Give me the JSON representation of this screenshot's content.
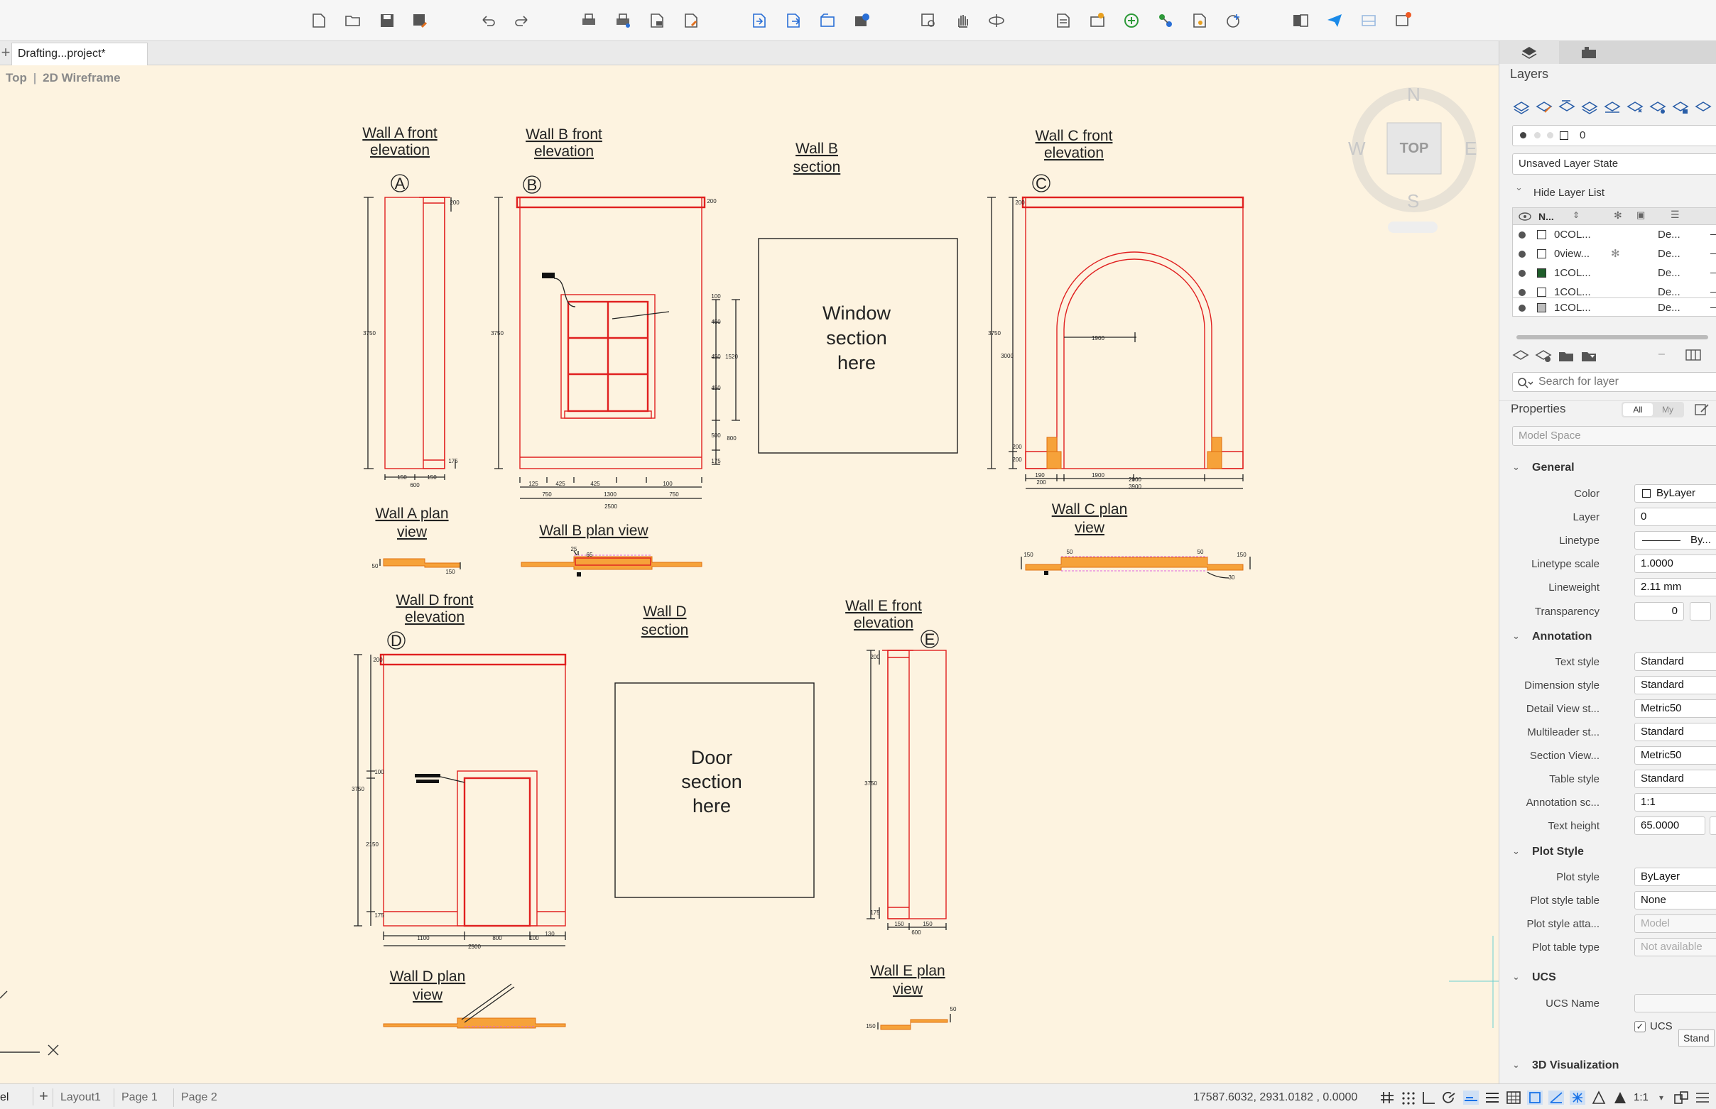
{
  "document": {
    "tab": "Drafting...project*"
  },
  "viewport": {
    "view": "Top",
    "visual_style": "2D Wireframe"
  },
  "navcube": {
    "face": "TOP",
    "north": "N",
    "south": "S",
    "east": "E",
    "west": "W"
  },
  "drawing": {
    "titles": {
      "wall_a_front": [
        "Wall A front",
        "elevation"
      ],
      "wall_b_front": [
        "Wall B front",
        "elevation"
      ],
      "wall_b_section": [
        "Wall B",
        "section"
      ],
      "wall_c_front": [
        "Wall C front",
        "elevation"
      ],
      "wall_a_plan": [
        "Wall A plan",
        "view"
      ],
      "wall_b_plan": "Wall B plan view",
      "wall_c_plan": [
        "Wall C plan",
        "view"
      ],
      "wall_d_front": [
        "Wall D front",
        "elevation"
      ],
      "wall_d_section": [
        "Wall D",
        "section"
      ],
      "wall_e_front": [
        "Wall E front",
        "elevation"
      ],
      "wall_d_plan": [
        "Wall D plan",
        "view"
      ],
      "wall_e_plan": [
        "Wall E plan",
        "view"
      ]
    },
    "boxes": {
      "window_section": [
        "Window",
        "section",
        "here"
      ],
      "door_section": [
        "Door",
        "section",
        "here"
      ]
    },
    "markers": {
      "a": "A",
      "b": "B",
      "c": "C",
      "d": "D",
      "e": "E"
    },
    "dims": {
      "wall_a_height": "3750",
      "wall_a_top": "200",
      "wall_a_base": "175",
      "wall_a_w1": "150",
      "wall_a_w2": "150",
      "wall_a_total": "600",
      "wall_b_height": "3750",
      "wall_b_top": "200",
      "wall_b_base": "175",
      "wall_b_s1": "100",
      "wall_b_s2": "450",
      "wall_b_s3": "450",
      "wall_b_s4": "450",
      "wall_b_s5": "500",
      "wall_b_win": "1520",
      "wall_b_low": "800",
      "wall_b_b1": "125",
      "wall_b_b2": "425",
      "wall_b_b3": "425",
      "wall_b_b4": "100",
      "wall_b_b5": "750",
      "wall_b_b6": "1300",
      "wall_b_b7": "750",
      "wall_b_total": "2500",
      "wall_b_plan_dim": "25",
      "wall_b_plan_dim2": "65",
      "wall_c_height": "3750",
      "wall_c_top": "200",
      "wall_c_arch": "3000",
      "wall_c_span": "1900",
      "wall_c_b1": "200",
      "wall_c_b2": "200",
      "wall_c_bb1": "190",
      "wall_c_bb2": "1900",
      "wall_c_bb3": "200",
      "wall_c_bb4": "2000",
      "wall_c_total": "3900",
      "wall_c_plan_l": "150",
      "wall_c_plan_d": "50",
      "wall_c_plan_r": "150",
      "wall_c_plan_r2": "50",
      "wall_c_plan_x": "30",
      "wall_a_plan_l": "50",
      "wall_a_plan_r": "150",
      "wall_d_height": "3750",
      "wall_d_top": "200",
      "wall_d_door": "2150",
      "wall_d_head": "100",
      "wall_d_base": "175",
      "wall_d_b1": "1100",
      "wall_d_b2": "800",
      "wall_d_b3": "100",
      "wall_d_b4": "130",
      "wall_d_total": "2500",
      "wall_e_height": "3750",
      "wall_e_top": "200",
      "wall_e_base": "175",
      "wall_e_b1": "150",
      "wall_e_b2": "150",
      "wall_e_total": "600",
      "wall_e_plan_l": "150",
      "wall_e_plan_r": "50"
    }
  },
  "panel": {
    "layers_title": "Layers",
    "current_layer": "0",
    "layer_state": "Unsaved Layer State",
    "hide_layer_list": "Hide Layer List",
    "layer_header_name": "N...",
    "layers": [
      {
        "name": "0COL...",
        "linetype": "De...",
        "color": "#ffffff"
      },
      {
        "name": "0view...",
        "linetype": "De...",
        "color": "#ffffff"
      },
      {
        "name": "1COL...",
        "linetype": "De...",
        "color": "#1f5d2a"
      },
      {
        "name": "1COL...",
        "linetype": "De...",
        "color": "#ffffff"
      },
      {
        "name": "1COL...",
        "linetype": "De...",
        "color": "#bdbdbd"
      }
    ],
    "search_placeholder": "Search for layer",
    "properties_title": "Properties",
    "filter_all": "All",
    "filter_my": "My",
    "space": "Model Space",
    "sections": {
      "general": "General",
      "annotation": "Annotation",
      "plot_style": "Plot Style",
      "ucs": "UCS",
      "visualization": "3D Visualization"
    },
    "general": {
      "color_label": "Color",
      "color_value": "ByLayer",
      "layer_label": "Layer",
      "layer_value": "0",
      "linetype_label": "Linetype",
      "linetype_value": "By...",
      "linetype_scale_label": "Linetype scale",
      "linetype_scale_value": "1.0000",
      "lineweight_label": "Lineweight",
      "lineweight_value": "2.11 mm",
      "transparency_label": "Transparency",
      "transparency_value": "0"
    },
    "annotation": {
      "text_style_label": "Text style",
      "text_style_value": "Standard",
      "dim_style_label": "Dimension style",
      "dim_style_value": "Standard",
      "detail_label": "Detail View st...",
      "detail_value": "Metric50",
      "mleader_label": "Multileader st...",
      "mleader_value": "Standard",
      "section_label": "Section View...",
      "section_value": "Metric50",
      "table_label": "Table style",
      "table_value": "Standard",
      "anno_scale_label": "Annotation sc...",
      "anno_scale_value": "1:1",
      "text_height_label": "Text height",
      "text_height_value": "65.0000"
    },
    "plot": {
      "plot_style_label": "Plot style",
      "plot_style_value": "ByLayer",
      "plot_table_label": "Plot style table",
      "plot_table_value": "None",
      "plot_attach_label": "Plot style atta...",
      "plot_attach_value": "Model",
      "plot_type_label": "Plot table type",
      "plot_type_value": "Not available"
    },
    "ucs": {
      "name_label": "UCS Name",
      "name_value": "",
      "checkbox_label": "UCS",
      "tooltip": "Stand"
    }
  },
  "status": {
    "model_tab": "el",
    "layout_tabs": [
      "Layout1",
      "Page 1",
      "Page 2"
    ],
    "coords": "17587.6032, 2931.0182 , 0.0000",
    "scale": "1:1"
  },
  "colors": {
    "canvas": "#fdf3e0",
    "line": "#e02020",
    "fill": "#f6a23a",
    "accent": "#1a73e8"
  }
}
